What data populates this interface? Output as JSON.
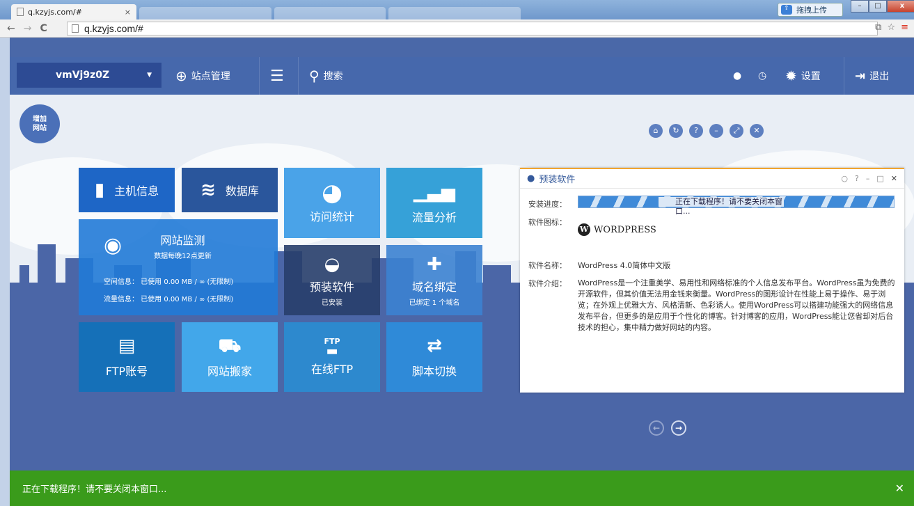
{
  "browser": {
    "tab_title": "q.kzyjs.com/#",
    "tab_close": "×",
    "url": "q.kzyjs.com/#",
    "upload_label": "拖拽上传",
    "win_min": "–",
    "win_max": "□",
    "win_close": "x"
  },
  "header": {
    "site_name": "vmVj9z0Z",
    "site_manage": "站点管理",
    "search": "搜索",
    "settings": "设置",
    "logout": "退出"
  },
  "add_site_label": "增加\n网站",
  "tiles": {
    "host_info": "主机信息",
    "database": "数据库",
    "visit_stats": "访问统计",
    "traffic": "流量分析",
    "monitor": "网站监测",
    "monitor_sub": "数据每晚12点更新",
    "space_info": "空间信息：  已使用 0.00 MB / ∞ (无限制)",
    "flow_info": "流量信息：  已使用 0.00 MB / ∞ (无限制)",
    "preinstall": "预装软件",
    "preinstall_sub": "已安装",
    "domain": "域名绑定",
    "domain_sub": "已绑定 1 个域名",
    "ftp_account": "FTP账号",
    "migrate": "网站搬家",
    "online_ftp": "在线FTP",
    "ftp_icon_text": "FTP",
    "script_switch": "脚本切换"
  },
  "panel": {
    "title": "预装软件",
    "progress_label": "安装进度：",
    "progress_text": "正在下载程序！请不要关闭本窗口...",
    "icon_label": "软件图标：",
    "wp_logo_text": "WORDPRESS",
    "name_label": "软件名称：",
    "name_value": "WordPress 4.0简体中文版",
    "intro_label": "软件介绍：",
    "intro_value": "WordPress是一个注重美学、易用性和网络标准的个人信息发布平台。WordPress虽为免费的开源软件，但其价值无法用金钱来衡量。WordPress的图形设计在性能上易于操作、易于浏览；在外观上优雅大方、风格清新、色彩诱人。使用WordPress可以搭建功能强大的网络信息发布平台，但更多的是应用于个性化的博客。针对博客的应用，WordPress能让您省却对后台技术的担心，集中精力做好网站的内容。"
  },
  "status": {
    "message": "正在下载程序！请不要关闭本窗口...",
    "close": "✕"
  },
  "colors": {
    "header_bg": "#4668ac",
    "status_green": "#3a9b1b",
    "panel_accent": "#f0a42e"
  }
}
